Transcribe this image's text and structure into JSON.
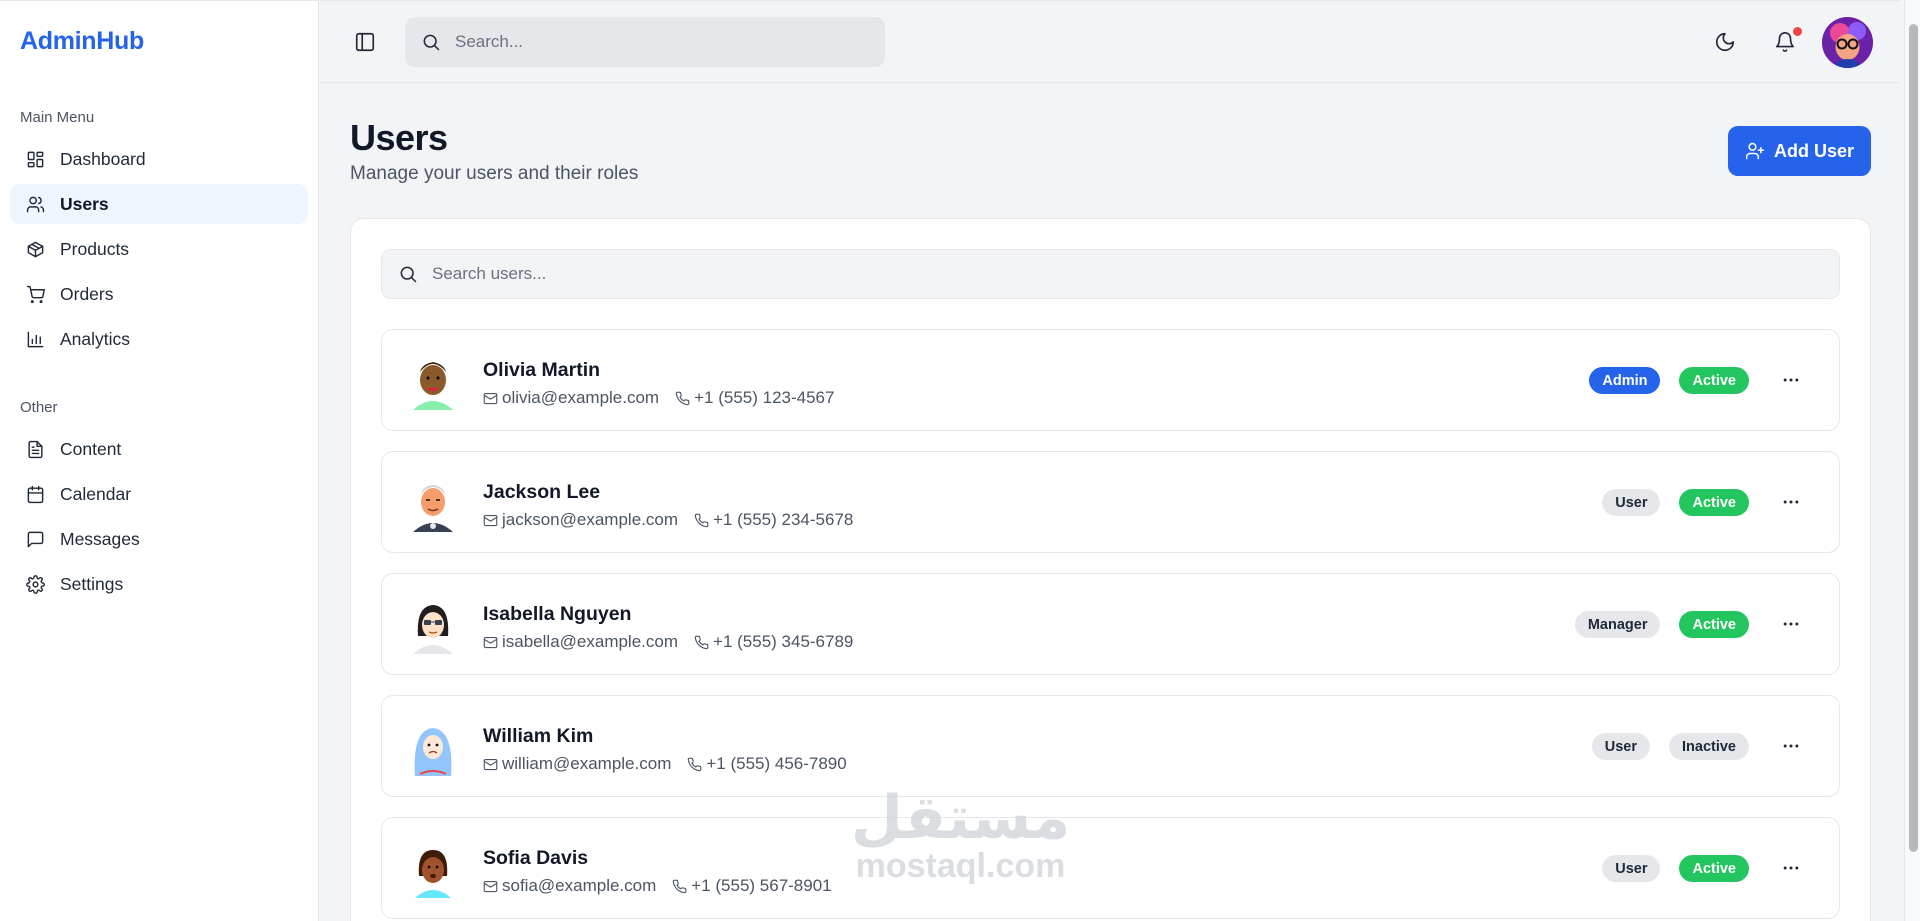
{
  "brand": "AdminHub",
  "sidebar": {
    "sections": [
      {
        "label": "Main Menu"
      },
      {
        "label": "Other"
      }
    ],
    "items": [
      {
        "label": "Dashboard",
        "icon": "dashboard-icon"
      },
      {
        "label": "Users",
        "icon": "users-icon",
        "active": true
      },
      {
        "label": "Products",
        "icon": "package-icon"
      },
      {
        "label": "Orders",
        "icon": "cart-icon"
      },
      {
        "label": "Analytics",
        "icon": "bar-chart-icon"
      },
      {
        "label": "Content",
        "icon": "file-text-icon"
      },
      {
        "label": "Calendar",
        "icon": "calendar-icon"
      },
      {
        "label": "Messages",
        "icon": "message-icon"
      },
      {
        "label": "Settings",
        "icon": "gear-icon"
      }
    ]
  },
  "header": {
    "search_placeholder": "Search..."
  },
  "main": {
    "title": "Users",
    "subtitle": "Manage your users and their roles",
    "add_button_label": "Add User",
    "user_search_placeholder": "Search users...",
    "users": [
      {
        "name": "Olivia Martin",
        "email": "olivia@example.com",
        "phone": "+1 (555) 123-4567",
        "role": "Admin",
        "status": "Active"
      },
      {
        "name": "Jackson Lee",
        "email": "jackson@example.com",
        "phone": "+1 (555) 234-5678",
        "role": "User",
        "status": "Active"
      },
      {
        "name": "Isabella Nguyen",
        "email": "isabella@example.com",
        "phone": "+1 (555) 345-6789",
        "role": "Manager",
        "status": "Active"
      },
      {
        "name": "William Kim",
        "email": "william@example.com",
        "phone": "+1 (555) 456-7890",
        "role": "User",
        "status": "Inactive"
      },
      {
        "name": "Sofia Davis",
        "email": "sofia@example.com",
        "phone": "+1 (555) 567-8901",
        "role": "User",
        "status": "Active"
      }
    ]
  },
  "watermark": {
    "arabic": "مستقل",
    "latin": "mostaql.com"
  },
  "colors": {
    "accent": "#2563eb",
    "active": "#22c55e",
    "notification": "#ef4444"
  }
}
